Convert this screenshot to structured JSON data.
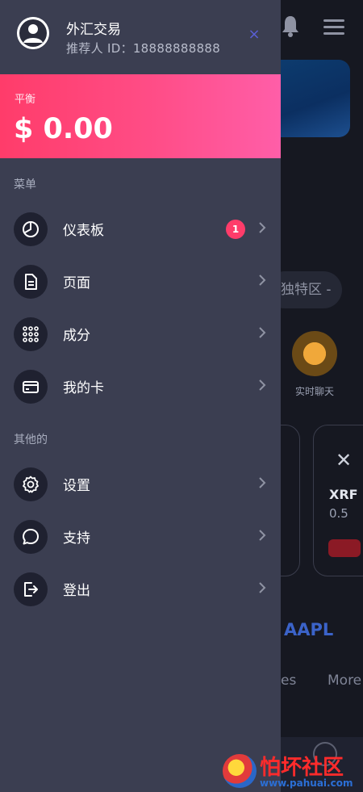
{
  "drawer": {
    "profile": {
      "name": "外汇交易",
      "referrer_id": "推荐人 ID：18888888888",
      "close_symbol": "×"
    },
    "balance": {
      "label": "平衡",
      "value": "$ 0.00"
    },
    "menu_section_title": "菜单",
    "menu_items": [
      {
        "label": "仪表板",
        "icon": "dashboard-icon",
        "badge": "1"
      },
      {
        "label": "页面",
        "icon": "document-icon"
      },
      {
        "label": "成分",
        "icon": "grid-icon"
      },
      {
        "label": "我的卡",
        "icon": "card-icon"
      }
    ],
    "other_section_title": "其他的",
    "other_items": [
      {
        "label": "设置",
        "icon": "gear-icon"
      },
      {
        "label": "支持",
        "icon": "chat-bubble-icon"
      },
      {
        "label": "登出",
        "icon": "logout-icon"
      }
    ]
  },
  "background": {
    "pill_text": "独特区 -",
    "chat_label": "实时聊天",
    "coin_symbol": "✕",
    "coin_name": "XRF",
    "coin_price": "0.5",
    "ticker": "AAPL",
    "tab_es": "es",
    "tab_more": "More"
  },
  "watermark": {
    "title": "怕坏社区",
    "url": "www.pahuai.com"
  },
  "colors": {
    "drawer_bg": "#3b3e51",
    "balance_gradient_start": "#ff3c6a",
    "balance_gradient_end": "#ff5ea8",
    "badge": "#ff3c6a",
    "close_icon": "#5a5fd6"
  }
}
